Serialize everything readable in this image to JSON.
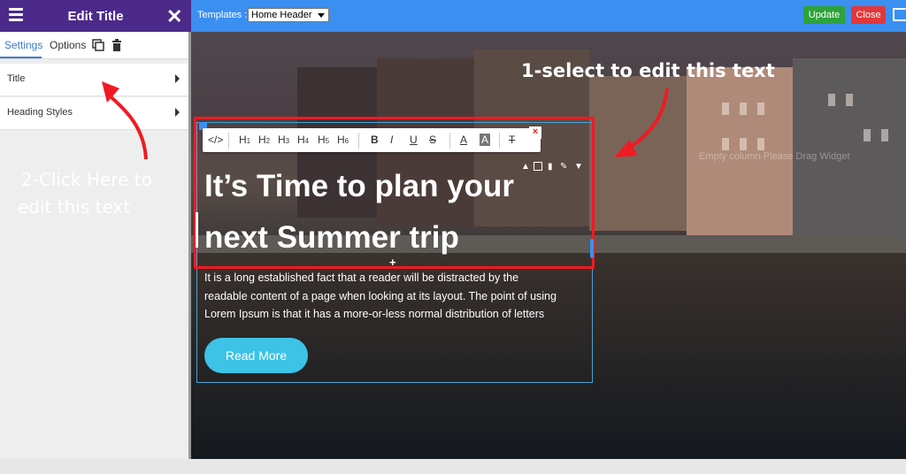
{
  "sidebar": {
    "title": "Edit Title",
    "tabs": {
      "settings": "Settings",
      "options": "Options"
    },
    "items": [
      {
        "label": "Title"
      },
      {
        "label": "Heading Styles"
      }
    ],
    "annotation_line1": "2-Click Here to",
    "annotation_line2": "edit this text"
  },
  "topbar": {
    "templates_label": "Templates :",
    "template_selected": "Home Header",
    "update_label": "Update",
    "close_label": "Close"
  },
  "editor": {
    "toolbar": {
      "code": "</>",
      "headings": [
        "H1",
        "H2",
        "H3",
        "H4",
        "H5",
        "H6"
      ],
      "bold": "B",
      "italic": "I",
      "underline": "U",
      "strike": "S",
      "font_color": "A",
      "highlight": "A",
      "clear_format": "T",
      "close": "×"
    },
    "annotation": "1-select to edit this text",
    "drop_hint": "Empty column Please Drag Widget",
    "heading_line1": "It’s Time to plan your",
    "heading_line2": "next Summer trip",
    "paragraph": [
      "It is a long established fact that a reader will be distracted by the",
      "readable content of a page when looking at its layout. The point of using",
      "Lorem Ipsum is that it has a more-or-less normal distribution of letters"
    ],
    "button_label": "Read More"
  },
  "colors": {
    "sidebar_header": "#4b2a8a",
    "topbar": "#3b8ff1",
    "update": "#2ea33a",
    "close": "#e2383b",
    "accent_red": "#f01a22",
    "read_more": "#3cc3e6"
  }
}
